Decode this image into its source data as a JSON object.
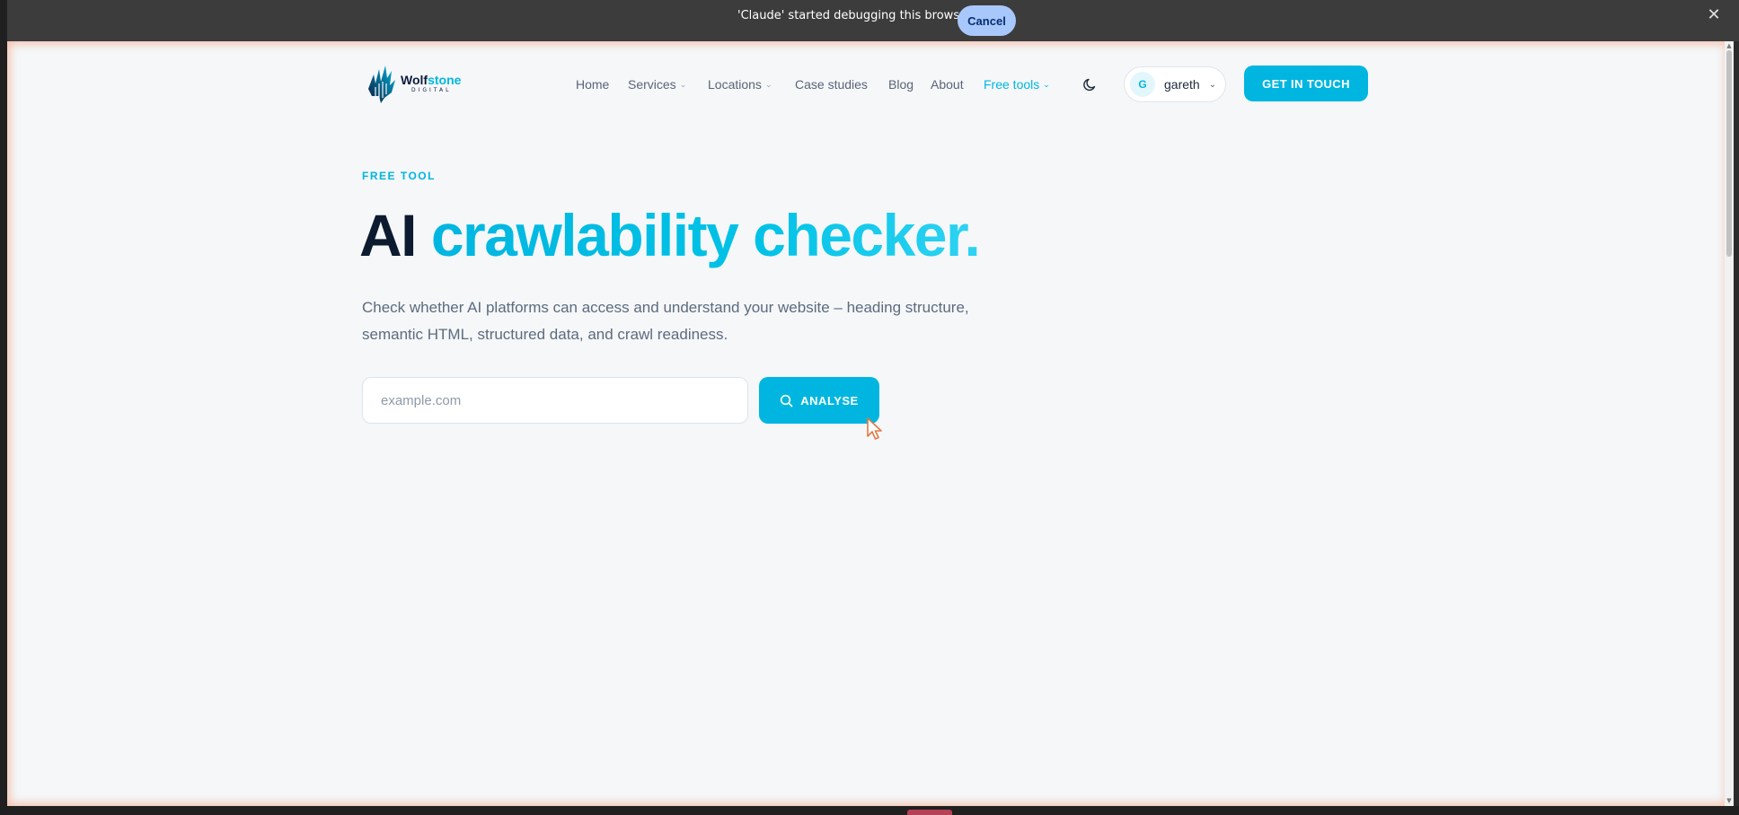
{
  "debug_banner": {
    "message": "'Claude' started debugging this browser",
    "cancel_label": "Cancel",
    "close_icon": "close-icon"
  },
  "header": {
    "logo": {
      "word1": "Wolf",
      "word2": "stone",
      "sub": "DIGITAL"
    },
    "nav": [
      {
        "label": "Home",
        "has_dropdown": false
      },
      {
        "label": "Services",
        "has_dropdown": true
      },
      {
        "label": "Locations",
        "has_dropdown": true
      },
      {
        "label": "Case studies",
        "has_dropdown": false
      },
      {
        "label": "Blog",
        "has_dropdown": false
      },
      {
        "label": "About",
        "has_dropdown": false
      },
      {
        "label": "Free tools",
        "has_dropdown": true,
        "active": true
      }
    ],
    "theme_toggle_icon": "moon-icon",
    "user": {
      "initial": "G",
      "name": "gareth"
    },
    "cta_label": "GET IN TOUCH"
  },
  "hero": {
    "eyebrow": "FREE TOOL",
    "title_dark": "AI",
    "title_accent": "crawlability checker.",
    "description": "Check whether AI platforms can access and understand your website – heading structure, semantic HTML, structured data, and crawl readiness.",
    "input_placeholder": "example.com",
    "input_value": "",
    "button_label": "ANALYSE",
    "button_icon": "search-icon"
  },
  "colors": {
    "accent": "#00b6e0",
    "heading_dark": "#0d1b30",
    "page_bg": "#f5f7f9",
    "debug_bar": "#3c3c3c",
    "cancel_button": "#a8c7fa"
  }
}
